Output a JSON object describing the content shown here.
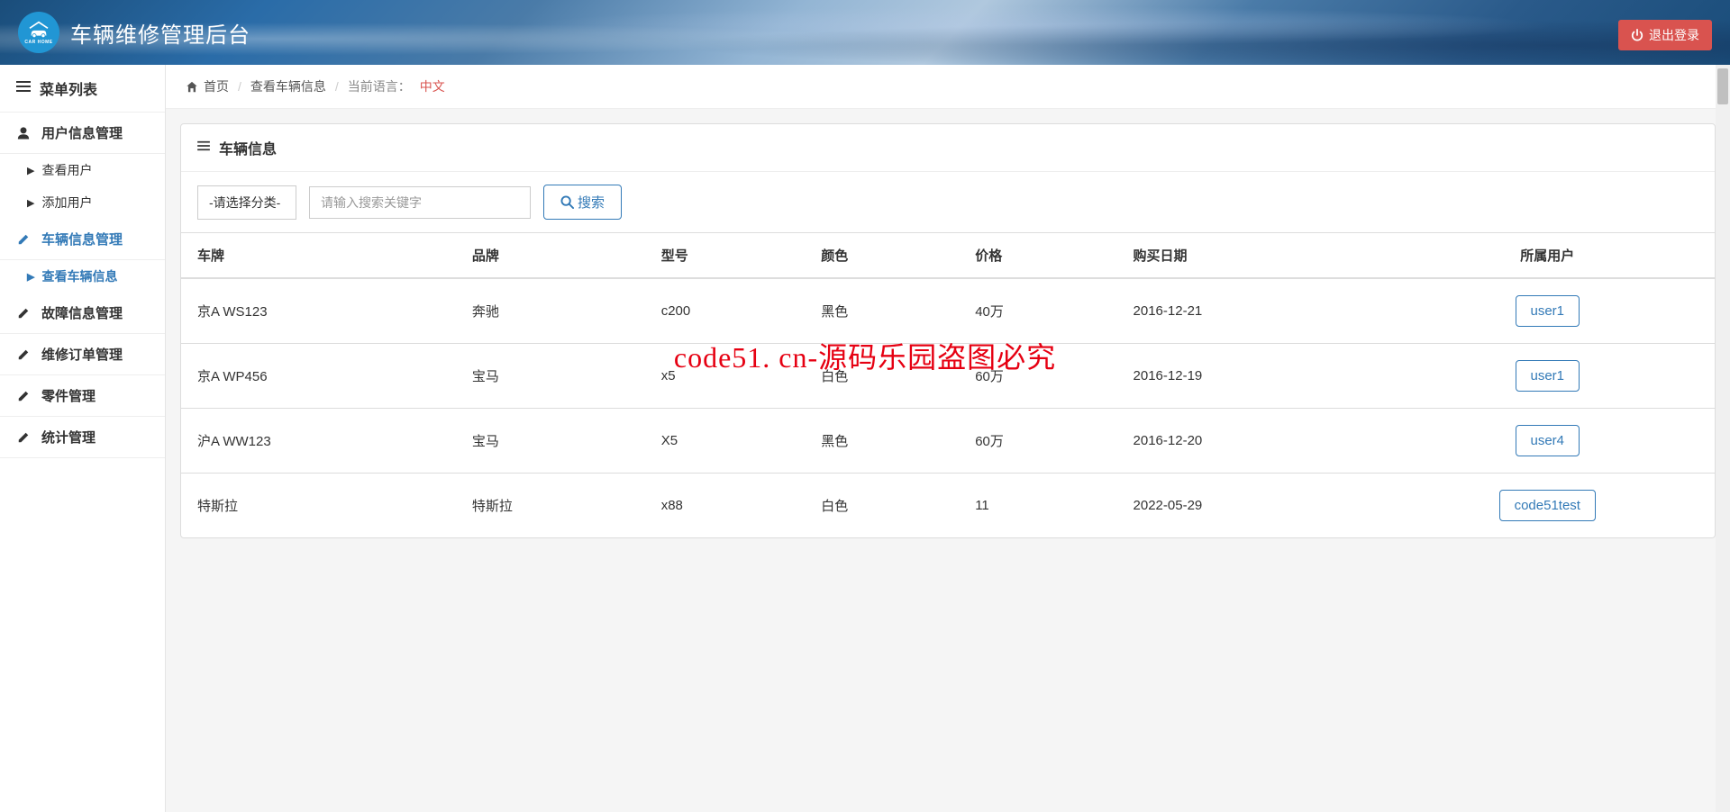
{
  "header": {
    "app_title": "车辆维修管理后台",
    "logo_small": "CAR HOME",
    "logout": "退出登录"
  },
  "sidebar": {
    "menu_title": "菜单列表",
    "sections": [
      {
        "label": "用户信息管理",
        "icon": "user",
        "active": false,
        "children": [
          {
            "label": "查看用户",
            "active": false
          },
          {
            "label": "添加用户",
            "active": false
          }
        ]
      },
      {
        "label": "车辆信息管理",
        "icon": "edit",
        "active": true,
        "children": [
          {
            "label": "查看车辆信息",
            "active": true
          }
        ]
      },
      {
        "label": "故障信息管理",
        "icon": "edit",
        "active": false,
        "children": []
      },
      {
        "label": "维修订单管理",
        "icon": "edit",
        "active": false,
        "children": []
      },
      {
        "label": "零件管理",
        "icon": "edit",
        "active": false,
        "children": []
      },
      {
        "label": "统计管理",
        "icon": "edit",
        "active": false,
        "children": []
      }
    ]
  },
  "breadcrumb": {
    "home": "首页",
    "current": "查看车辆信息",
    "lang_label": "当前语言：",
    "lang_value": "中文"
  },
  "panel": {
    "title": "车辆信息",
    "category_placeholder": "-请选择分类-",
    "search_placeholder": "请输入搜索关键字",
    "search_btn": "搜索"
  },
  "table": {
    "columns": [
      "车牌",
      "品牌",
      "型号",
      "颜色",
      "价格",
      "购买日期",
      "所属用户"
    ],
    "rows": [
      {
        "plate": "京A WS123",
        "brand": "奔驰",
        "model": "c200",
        "color": "黑色",
        "price": "40万",
        "date": "2016-12-21",
        "user": "user1"
      },
      {
        "plate": "京A WP456",
        "brand": "宝马",
        "model": "x5",
        "color": "白色",
        "price": "60万",
        "date": "2016-12-19",
        "user": "user1"
      },
      {
        "plate": "沪A WW123",
        "brand": "宝马",
        "model": "X5",
        "color": "黑色",
        "price": "60万",
        "date": "2016-12-20",
        "user": "user4"
      },
      {
        "plate": "特斯拉",
        "brand": "特斯拉",
        "model": "x88",
        "color": "白色",
        "price": "11",
        "date": "2022-05-29",
        "user": "code51test"
      }
    ]
  },
  "watermark": "code51. cn-源码乐园盗图必究"
}
